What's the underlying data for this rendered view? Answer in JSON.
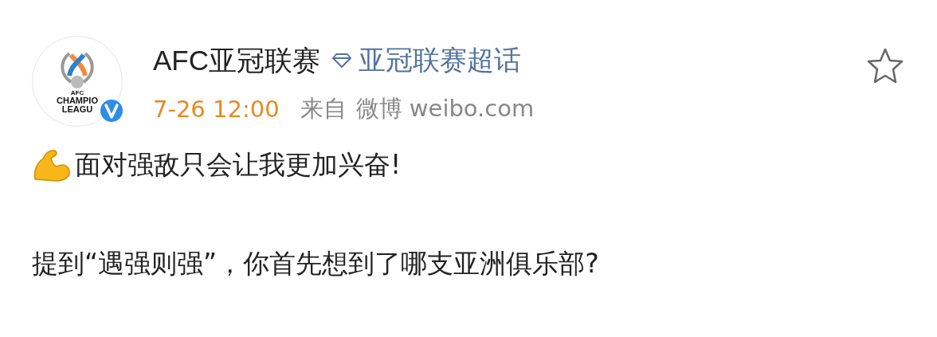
{
  "post": {
    "avatar": {
      "logo_lines": [
        "AFC",
        "CHAMPIO",
        "LEAGU"
      ],
      "verified": true
    },
    "author": "AFC亚冠联赛",
    "topic": "亚冠联赛超话",
    "time": "7-26 12:00",
    "source_prefix": "来自",
    "source": "微博 weibo.com",
    "favorited": false,
    "paragraphs": [
      {
        "kind": "emoji",
        "text": "面对强敌只会让我更加兴奋!"
      },
      {
        "kind": "plain",
        "text": "提到“遇强则强”，你首先想到了哪支亚洲俱乐部?"
      }
    ]
  }
}
